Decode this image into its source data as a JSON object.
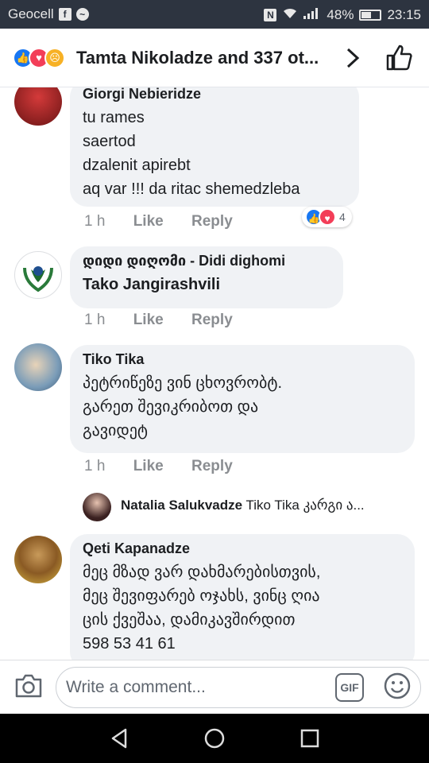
{
  "status": {
    "carrier": "Geocell",
    "battery": "48%",
    "time": "23:15"
  },
  "header": {
    "title": "Tamta Nikoladze and 337 ot...",
    "reaction_icons": [
      "like",
      "love",
      "sad"
    ]
  },
  "comments": [
    {
      "author": "Giorgi Nebieridze",
      "lines": [
        "tu rames",
        "saertod",
        "dzalenit apirebt",
        "aq var !!! da ritac shemedzleba"
      ],
      "time": "1 h",
      "like": "Like",
      "reply": "Reply",
      "reaction_count": "4"
    },
    {
      "author": "დიდი დიღომი - Didi dighomi",
      "lines": [
        "Tako Jangirashvili"
      ],
      "time": "1 h",
      "like": "Like",
      "reply": "Reply"
    },
    {
      "author": "Tiko Tika",
      "lines": [
        "პეტრიწეზე ვინ ცხოვრობტ.",
        "გარეთ შევიკრიბოთ და",
        "გავიდეტ"
      ],
      "time": "1 h",
      "like": "Like",
      "reply": "Reply",
      "reply_preview": {
        "author": "Natalia Salukvadze",
        "text": "Tiko Tika კარგი ა..."
      }
    },
    {
      "author": "Qeti Kapanadze",
      "lines": [
        "მეც მზად ვარ დახმარებისთვის,",
        "მეც შევიფარებ ოჯახს, ვინც ღია",
        "ცის ქვეშაა, დამიკავშირდით",
        "598 53 41 61"
      ]
    }
  ],
  "composer": {
    "placeholder": "Write a comment...",
    "gif_label": "GIF"
  },
  "colors": {
    "status_bar": "#2d3440",
    "bubble": "#f0f2f5",
    "like_blue": "#1877f2",
    "love_red": "#f33e58"
  }
}
